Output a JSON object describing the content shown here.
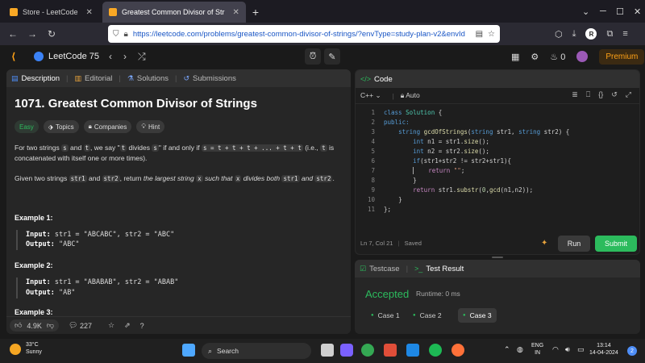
{
  "browser": {
    "tabs": [
      {
        "title": "Store - LeetCode",
        "active": false
      },
      {
        "title": "Greatest Common Divisor of Str",
        "active": true
      }
    ],
    "new_tab": "+",
    "url": "https://leetcode.com/problems/greatest-common-divisor-of-strings/?envType=study-plan-v2&envId",
    "profile_initial": "R"
  },
  "lc_header": {
    "study_plan": "LeetCode 75",
    "streak": "0",
    "premium_label": "Premium"
  },
  "left_tabs": [
    {
      "label": "Description",
      "icon": "description-icon"
    },
    {
      "label": "Editorial",
      "icon": "editorial-icon"
    },
    {
      "label": "Solutions",
      "icon": "solutions-icon"
    },
    {
      "label": "Submissions",
      "icon": "submissions-icon"
    }
  ],
  "problem": {
    "title": "1071. Greatest Common Divisor of Strings",
    "tags": [
      {
        "label": "Easy"
      },
      {
        "label": "Topics"
      },
      {
        "label": "Companies"
      },
      {
        "label": "Hint"
      }
    ],
    "p1": {
      "a": "For two strings ",
      "s": "s",
      "b": " and ",
      "t": "t",
      "c": ", we say \"",
      "t2": "t",
      "d": " divides ",
      "s2": "s",
      "e": "\" if and only if ",
      "expr": "s = t + t + t + ... + t + t",
      "f": " (i.e., ",
      "t3": "t",
      "g": " is concatenated with itself one or more times)."
    },
    "p2": {
      "a": "Given two strings ",
      "str1": "str1",
      "b": " and ",
      "str2": "str2",
      "c": ", return ",
      "d": "the largest string ",
      "x": "x",
      "e": " such that ",
      "x2": "x",
      "f": " divides both ",
      "str1b": "str1",
      "g": " and ",
      "str2b": "str2",
      "h": "."
    },
    "examples": [
      {
        "heading": "Example 1:",
        "input_label": "Input:",
        "input": "str1 = \"ABCABC\", str2 = \"ABC\"",
        "output_label": "Output:",
        "output": "\"ABC\""
      },
      {
        "heading": "Example 2:",
        "input_label": "Input:",
        "input": "str1 = \"ABABAB\", str2 = \"ABAB\"",
        "output_label": "Output:",
        "output": "\"AB\""
      },
      {
        "heading": "Example 3:"
      }
    ]
  },
  "left_footer": {
    "likes": "4.9K",
    "comments": "227"
  },
  "code_panel": {
    "title": "Code",
    "language": "C++",
    "auto": "Auto",
    "lines": [
      {
        "n": "1"
      },
      {
        "n": "2"
      },
      {
        "n": "3"
      },
      {
        "n": "4"
      },
      {
        "n": "5"
      },
      {
        "n": "6"
      },
      {
        "n": "7"
      },
      {
        "n": "8"
      },
      {
        "n": "9"
      },
      {
        "n": "10"
      },
      {
        "n": "11"
      }
    ],
    "status": "Ln 7, Col 21",
    "saved": "Saved",
    "run_label": "Run",
    "submit_label": "Submit",
    "code": {
      "l1_kw": "class",
      "l1_ty": "Solution",
      "l1_rest": " {",
      "l2": "public:",
      "l3_ty": "string",
      "l3_fn": "gcdOfStrings",
      "l3_a": "(",
      "l3_t1": "string",
      "l3_b": " str1, ",
      "l3_t2": "string",
      "l3_c": " str2) {",
      "l4_kw": "int",
      "l4_a": " n1 = str1.",
      "l4_fn": "size",
      "l4_b": "();",
      "l5_kw": "int",
      "l5_a": " n2 = str2.",
      "l5_fn": "size",
      "l5_b": "();",
      "l6_kw": "if",
      "l6_a": "(str1+str2 != str2+str1){",
      "l7_kw": "return",
      "l7_str": "\"\"",
      "l7_b": ";",
      "l8": "}",
      "l9_kw": "return",
      "l9_a": " str1.",
      "l9_fn": "substr",
      "l9_b": "(",
      "l9_num": "0",
      "l9_c": ",",
      "l9_fn2": "gcd",
      "l9_d": "(n1,n2));",
      "l10": "}",
      "l11": "};"
    }
  },
  "result_panel": {
    "tabs": [
      {
        "label": "Testcase"
      },
      {
        "label": "Test Result"
      }
    ],
    "verdict": "Accepted",
    "runtime": "Runtime: 0 ms",
    "cases": [
      {
        "label": "Case 1",
        "active": false
      },
      {
        "label": "Case 2",
        "active": false
      },
      {
        "label": "Case 3",
        "active": true
      }
    ]
  },
  "taskbar": {
    "weather_temp": "33°C",
    "weather_desc": "Sunny",
    "search_placeholder": "Search",
    "lang_line1": "ENG",
    "lang_line2": "IN",
    "time": "13:14",
    "date": "14-04-2024",
    "notifications": "2"
  },
  "colors": {
    "accent_green": "#2cbb5d",
    "brand_orange": "#ffa116"
  }
}
